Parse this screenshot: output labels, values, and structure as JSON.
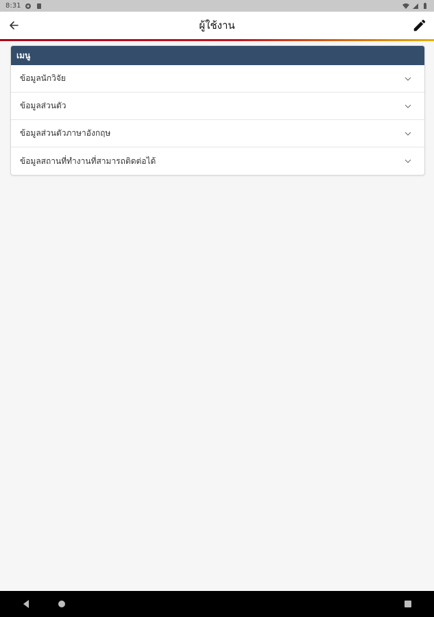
{
  "status_bar": {
    "time": "8:31",
    "icons": [
      "settings-gear-icon",
      "sim-card-icon",
      "wifi-icon",
      "signal-icon",
      "battery-icon"
    ]
  },
  "app_bar": {
    "title": "ผู้ใช้งาน",
    "back_icon": "arrow-back-icon",
    "edit_icon": "pencil-icon"
  },
  "colors": {
    "header_bg": "#334d6b",
    "accent_red": "#c4141e",
    "accent_yellow": "#e8b000"
  },
  "menu": {
    "header": "เมนู",
    "items": [
      {
        "label": "ข้อมูลนักวิจัย"
      },
      {
        "label": "ข้อมูลส่วนตัว"
      },
      {
        "label": "ข้อมูลส่วนตัวภาษาอังกฤษ"
      },
      {
        "label": "ข้อมูลสถานที่ทำงานที่สามารถติดต่อได้"
      }
    ]
  },
  "nav_bar": {
    "icons": [
      "back-triangle-icon",
      "home-circle-icon",
      "recents-square-icon"
    ]
  }
}
